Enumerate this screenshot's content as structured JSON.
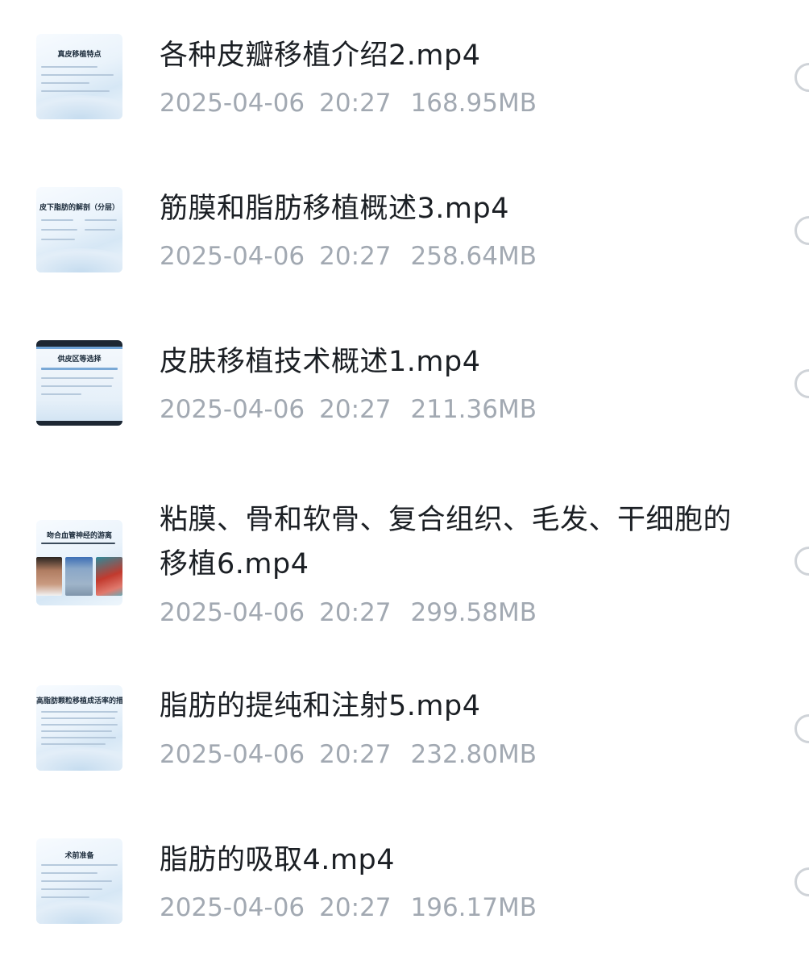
{
  "files": [
    {
      "name": "各种皮瓣移植介绍2.mp4",
      "date": "2025-04-06",
      "time": "20:27",
      "size": "168.95MB",
      "thumb_text": "真皮移植特点"
    },
    {
      "name": "筋膜和脂肪移植概述3.mp4",
      "date": "2025-04-06",
      "time": "20:27",
      "size": "258.64MB",
      "thumb_text": "皮下脂肪的解剖（分层）"
    },
    {
      "name": "皮肤移植技术概述1.mp4",
      "date": "2025-04-06",
      "time": "20:27",
      "size": "211.36MB",
      "thumb_text": "供皮区等选择"
    },
    {
      "name": "粘膜、骨和软骨、复合组织、毛发、干细胞的移植6.mp4",
      "date": "2025-04-06",
      "time": "20:27",
      "size": "299.58MB",
      "thumb_text": "吻合血管神经的游离"
    },
    {
      "name": "脂肪的提纯和注射5.mp4",
      "date": "2025-04-06",
      "time": "20:27",
      "size": "232.80MB",
      "thumb_text": "高脂肪颗粒移植成活率的措"
    },
    {
      "name": "脂肪的吸取4.mp4",
      "date": "2025-04-06",
      "time": "20:27",
      "size": "196.17MB",
      "thumb_text": "术前准备"
    }
  ]
}
